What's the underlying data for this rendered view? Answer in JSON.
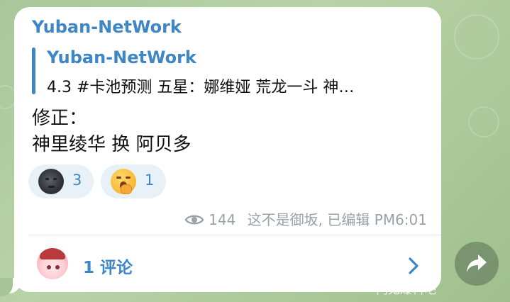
{
  "channel": {
    "name": "Yuban-NetWork"
  },
  "quote": {
    "title": "Yuban-NetWork",
    "text": "4.3 #卡池预测 五星：娜维娅 荒龙一斗 神…"
  },
  "message": {
    "line1": "修正：",
    "line2": "神里绫华 换 阿贝多"
  },
  "reactions": [
    {
      "icon": "new-moon-face-icon",
      "count": "3"
    },
    {
      "icon": "yawning-face-icon",
      "count": "1"
    }
  ],
  "meta": {
    "views": "144",
    "author": "这不是御坂,",
    "edited": "已编辑",
    "time": "PM6:01"
  },
  "comments": {
    "label": "1 评论"
  },
  "watermark": {
    "text": "内鬼爆料吧"
  },
  "colors": {
    "accent": "#3e86c6",
    "bubble": "#ffffff",
    "reaction_bg": "#e8f1f8",
    "meta": "#9aa1a8"
  }
}
